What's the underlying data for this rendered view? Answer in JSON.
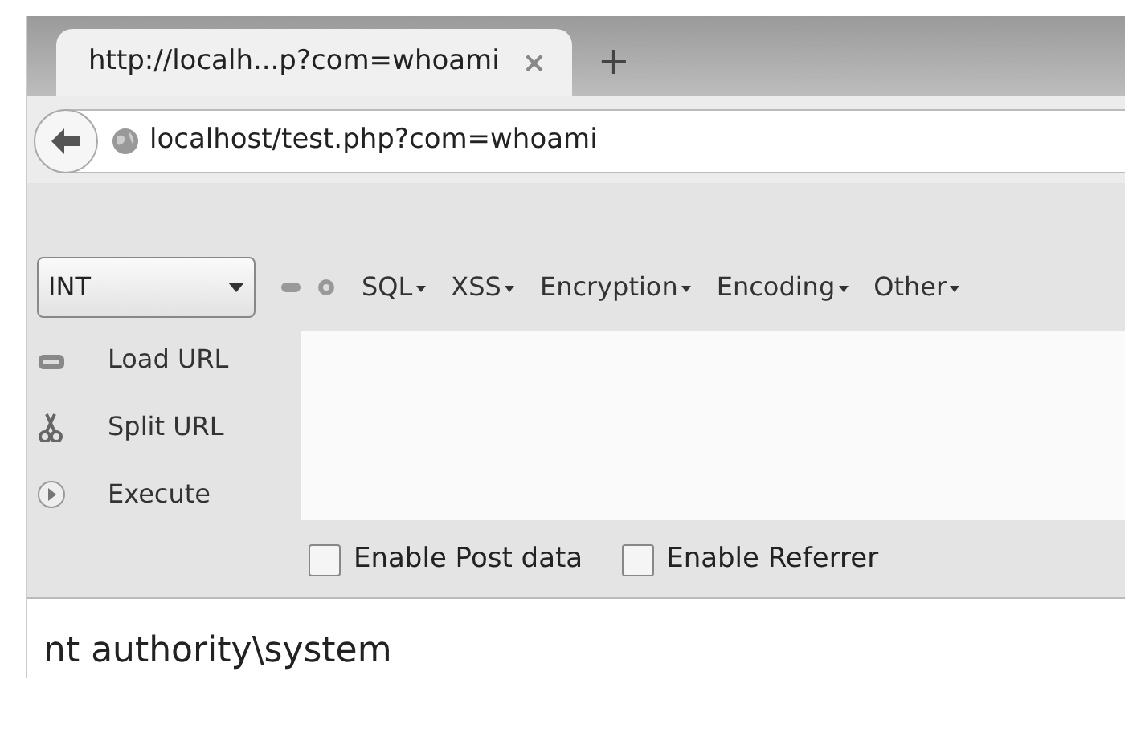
{
  "tab": {
    "title": "http://localh...p?com=whoami",
    "close": "×",
    "new_tab": "+"
  },
  "address_bar": {
    "url": "localhost/test.php?com=whoami"
  },
  "hackbar": {
    "select": {
      "value": "INT"
    },
    "menus": [
      {
        "label": "SQL"
      },
      {
        "label": "XSS"
      },
      {
        "label": "Encryption"
      },
      {
        "label": "Encoding"
      },
      {
        "label": "Other"
      }
    ],
    "actions": [
      {
        "kind": "load",
        "label": "Load URL"
      },
      {
        "kind": "split",
        "label": "Split URL"
      },
      {
        "kind": "execute",
        "label": "Execute"
      }
    ],
    "options": [
      {
        "label": "Enable Post data",
        "checked": false
      },
      {
        "label": "Enable Referrer",
        "checked": false
      }
    ]
  },
  "page": {
    "output": "nt authority\\system"
  }
}
